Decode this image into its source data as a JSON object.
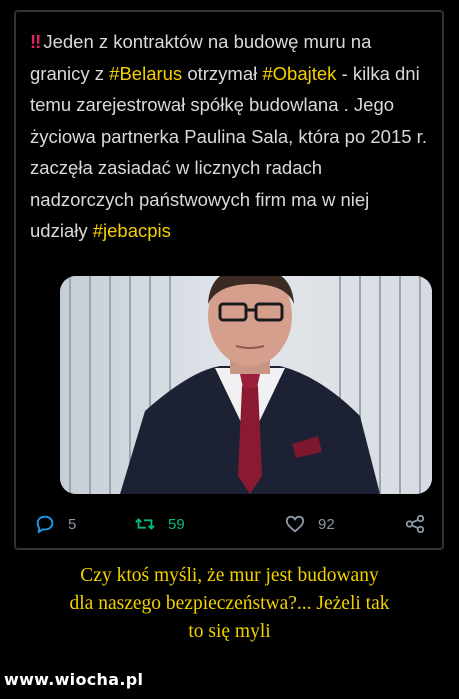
{
  "tweet": {
    "text_part1": "Jeden z kontraktów na budowę muru na granicy z ",
    "hashtag1": "#Belarus",
    "text_part2": " otrzymał ",
    "hashtag2": "#Obajtek",
    "text_part3": " - kilka dni temu zarejestrował spółkę budowlana . Jego życiowa partnerka Paulina Sala, która po 2015 r. zaczęła zasiadać w licznych radach nadzorczych państwowych firm ma w niej udziały ",
    "hashtag3": "#jebacpis",
    "media_alt": "man in dark suit and red tie",
    "reply_count": "5",
    "retweet_count": "59",
    "like_count": "92"
  },
  "icons": {
    "bang": "double-exclamation-icon",
    "reply": "reply-icon",
    "retweet": "retweet-icon",
    "like": "heart-icon",
    "share": "share-icon"
  },
  "colors": {
    "hashtag": "#f5d000",
    "exclamation": "#e0245e",
    "reply": "#1d9bf0",
    "retweet": "#00ba7c",
    "muted": "#8b98a5",
    "caption": "#f3d200"
  },
  "caption": {
    "line1": "Czy ktoś myśli, że mur jest budowany",
    "line2": "dla naszego bezpieczeństwa?... Jeżeli tak",
    "line3": "to się myli"
  },
  "watermark": "www.wiocha.pl"
}
